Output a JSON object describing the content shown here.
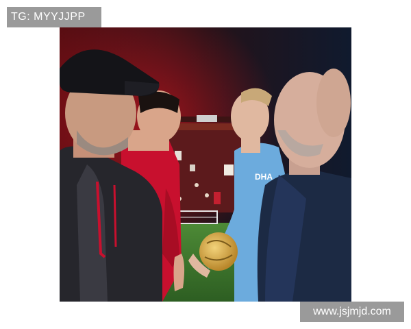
{
  "watermarks": {
    "top_left": "TG: MYYJJPP",
    "bottom_right": "www.jsjmjd.com"
  },
  "photo": {
    "jersey_text": "DHA"
  },
  "colors": {
    "red_kit": "#c8102e",
    "blue_kit": "#6cabdd",
    "navy_jacket": "#1c2a44",
    "pitch": "#3e7a2e"
  }
}
